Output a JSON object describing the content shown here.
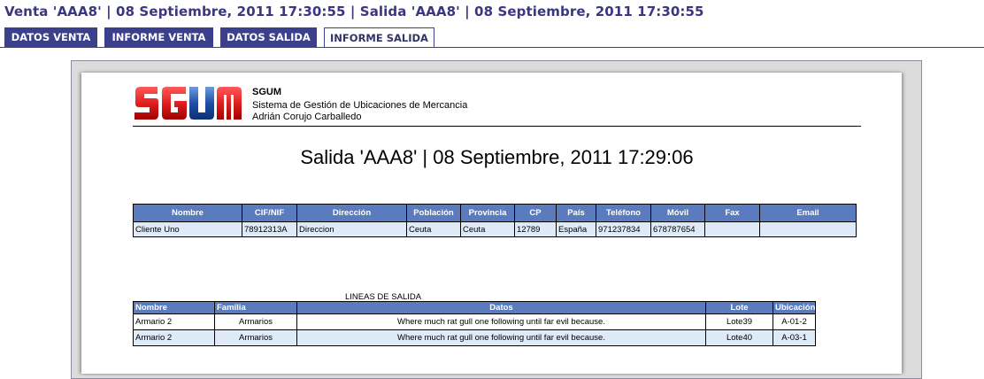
{
  "header": {
    "title": "Venta 'AAA8' | 08 Septiembre, 2011 17:30:55 | Salida 'AAA8' | 08 Septiembre, 2011 17:30:55"
  },
  "tabs": [
    {
      "label": "DATOS VENTA",
      "active": false
    },
    {
      "label": "INFORME VENTA",
      "active": false
    },
    {
      "label": "DATOS SALIDA",
      "active": false
    },
    {
      "label": "INFORME SALIDA",
      "active": true
    }
  ],
  "report": {
    "logo_text": "SGUM",
    "company": {
      "name": "SGUM",
      "subtitle": "Sistema de Gestión de Ubicaciones de Mercancia",
      "author": "Adrián Corujo Carballedo"
    },
    "title": "Salida 'AAA8' | 08 Septiembre, 2011 17:29:06",
    "client_table": {
      "headers": [
        "Nombre",
        "CIF/NIF",
        "Dirección",
        "Población",
        "Provincia",
        "CP",
        "País",
        "Teléfono",
        "Móvil",
        "Fax",
        "Email"
      ],
      "row": [
        "Cliente Uno",
        "78912313A",
        "Direccion",
        "Ceuta",
        "Ceuta",
        "12789",
        "España",
        "971237834",
        "678787654",
        "",
        ""
      ]
    },
    "lines_caption": "LINEAS DE SALIDA",
    "lines_table": {
      "headers": [
        "Nombre",
        "Familia",
        "Datos",
        "Lote",
        "Ubicación"
      ],
      "rows": [
        [
          "Armario 2",
          "Armarios",
          "Where much rat gull one following until far evil because.",
          "Lote39",
          "A-01-2"
        ],
        [
          "Armario 2",
          "Armarios",
          "Where much rat gull one following until far evil because.",
          "Lote40",
          "A-03-1"
        ]
      ]
    }
  },
  "colors": {
    "accent": "#3b3f8c",
    "table_header": "#5b7bbf",
    "table_row": "#dfeaf8",
    "logo_red": "#e02020",
    "logo_blue": "#1f4fa8"
  }
}
